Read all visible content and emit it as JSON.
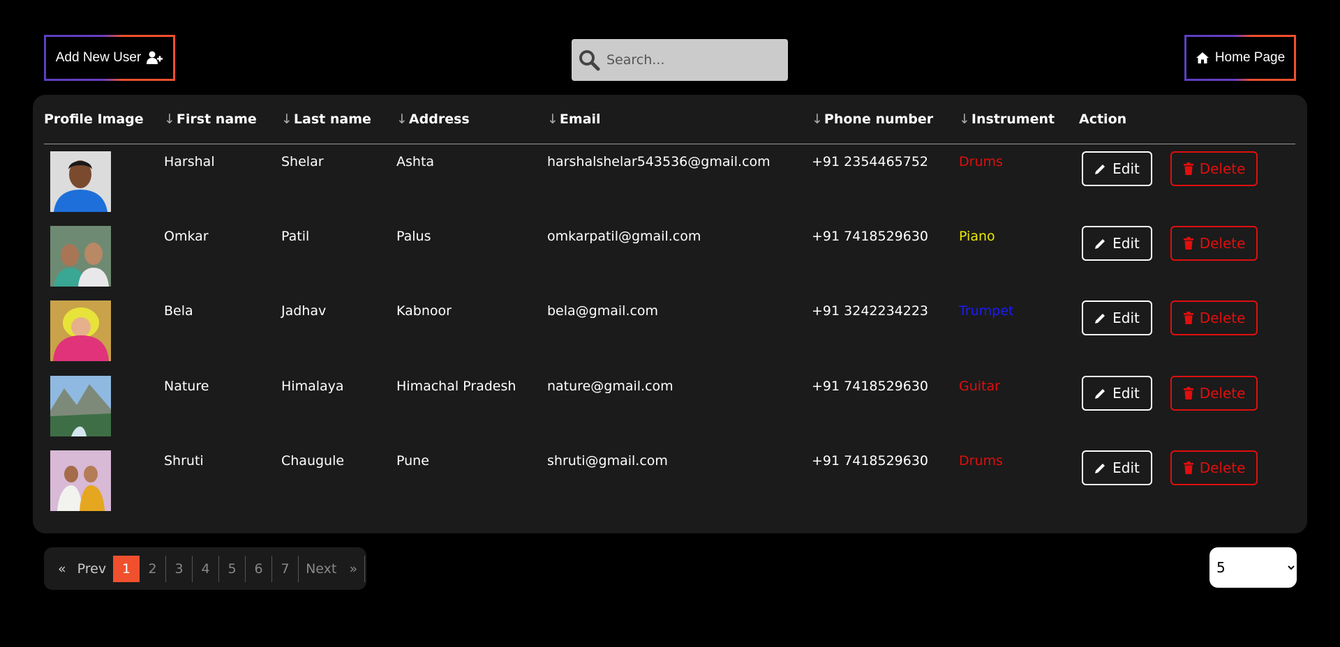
{
  "header": {
    "add_user_label": "Add New User",
    "home_label": "Home Page",
    "search_placeholder": "Search..."
  },
  "table": {
    "columns": {
      "profile": "Profile Image",
      "first": "First name",
      "last": "Last name",
      "address": "Address",
      "email": "Email",
      "phone": "Phone number",
      "instrument": "Instrument",
      "action": "Action"
    },
    "edit_label": "Edit",
    "delete_label": "Delete",
    "rows": [
      {
        "first": "Harshal",
        "last": "Shelar",
        "address": "Ashta",
        "email": "harshalshelar543536@gmail.com",
        "phone": "+91 2354465752",
        "instrument": "Drums",
        "instrument_color": "#e10e0e"
      },
      {
        "first": "Omkar",
        "last": "Patil",
        "address": "Palus",
        "email": "omkarpatil@gmail.com",
        "phone": "+91 7418529630",
        "instrument": "Piano",
        "instrument_color": "#e8e800"
      },
      {
        "first": "Bela",
        "last": "Jadhav",
        "address": "Kabnoor",
        "email": "bela@gmail.com",
        "phone": "+91 3242234223",
        "instrument": "Trumpet",
        "instrument_color": "#1a1aff"
      },
      {
        "first": "Nature",
        "last": "Himalaya",
        "address": "Himachal Pradesh",
        "email": "nature@gmail.com",
        "phone": "+91 7418529630",
        "instrument": "Guitar",
        "instrument_color": "#e10e0e"
      },
      {
        "first": "Shruti",
        "last": "Chaugule",
        "address": "Pune",
        "email": "shruti@gmail.com",
        "phone": "+91 7418529630",
        "instrument": "Drums",
        "instrument_color": "#e10e0e"
      }
    ]
  },
  "pagination": {
    "first_symbol": "«",
    "prev_label": "Prev",
    "pages": [
      "1",
      "2",
      "3",
      "4",
      "5",
      "6",
      "7"
    ],
    "next_label": "Next",
    "last_symbol": "»",
    "per_page": "5"
  },
  "colors": {
    "accent": "#f0502e",
    "delete": "#e10e0e",
    "panel": "#1b1b1b"
  }
}
